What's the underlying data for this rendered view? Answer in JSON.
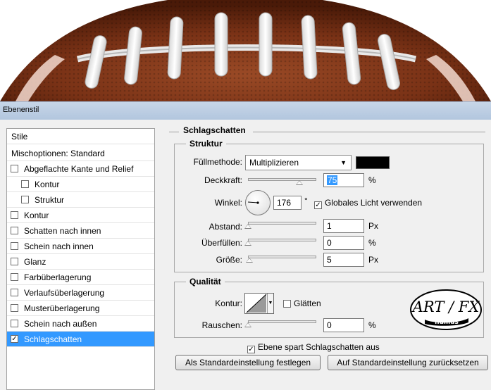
{
  "dialog": {
    "title": "Ebenenstil"
  },
  "style_list": {
    "header": "Stile",
    "items": [
      {
        "label": "Mischoptionen: Standard",
        "checkbox": false,
        "checked": false,
        "indent": 0,
        "selected": false
      },
      {
        "label": "Abgeflachte Kante und Relief",
        "checkbox": true,
        "checked": false,
        "indent": 0,
        "selected": false
      },
      {
        "label": "Kontur",
        "checkbox": true,
        "checked": false,
        "indent": 1,
        "selected": false
      },
      {
        "label": "Struktur",
        "checkbox": true,
        "checked": false,
        "indent": 1,
        "selected": false
      },
      {
        "label": "Kontur",
        "checkbox": true,
        "checked": false,
        "indent": 0,
        "selected": false
      },
      {
        "label": "Schatten nach innen",
        "checkbox": true,
        "checked": false,
        "indent": 0,
        "selected": false
      },
      {
        "label": "Schein nach innen",
        "checkbox": true,
        "checked": false,
        "indent": 0,
        "selected": false
      },
      {
        "label": "Glanz",
        "checkbox": true,
        "checked": false,
        "indent": 0,
        "selected": false
      },
      {
        "label": "Farbüberlagerung",
        "checkbox": true,
        "checked": false,
        "indent": 0,
        "selected": false
      },
      {
        "label": "Verlaufsüberlagerung",
        "checkbox": true,
        "checked": false,
        "indent": 0,
        "selected": false
      },
      {
        "label": "Musterüberlagerung",
        "checkbox": true,
        "checked": false,
        "indent": 0,
        "selected": false
      },
      {
        "label": "Schein nach außen",
        "checkbox": true,
        "checked": false,
        "indent": 0,
        "selected": false
      },
      {
        "label": "Schlagschatten",
        "checkbox": true,
        "checked": true,
        "indent": 0,
        "selected": true
      }
    ]
  },
  "panel": {
    "title": "Schlagschatten",
    "struktur": {
      "title": "Struktur",
      "fuellmethode_label": "Füllmethode:",
      "fuellmethode_value": "Multiplizieren",
      "color": "#000000",
      "deckkraft_label": "Deckkraft:",
      "deckkraft_value": "75",
      "deckkraft_fraction": 0.75,
      "deckkraft_unit": "%",
      "winkel_label": "Winkel:",
      "winkel_value": "176",
      "winkel_unit": "°",
      "global_light_label": "Globales Licht verwenden",
      "global_light_checked": true,
      "abstand_label": "Abstand:",
      "abstand_value": "1",
      "abstand_unit": "Px",
      "abstand_fraction": 0.0,
      "ueberfuellen_label": "Überfüllen:",
      "ueberfuellen_value": "0",
      "ueberfuellen_unit": "%",
      "ueberfuellen_fraction": 0.0,
      "groesse_label": "Größe:",
      "groesse_value": "5",
      "groesse_unit": "Px",
      "groesse_fraction": 0.02
    },
    "qualitaet": {
      "title": "Qualität",
      "kontur_label": "Kontur:",
      "glaetten_label": "Glätten",
      "glaetten_checked": false,
      "rauschen_label": "Rauschen:",
      "rauschen_value": "0",
      "rauschen_unit": "%",
      "rauschen_fraction": 0.0
    },
    "ebene_label": "Ebene spart Schlagschatten aus",
    "ebene_checked": true,
    "btn_default_set": "Als Standardeinstellung festlegen",
    "btn_default_reset": "Auf Standardeinstellung zurücksetzen"
  },
  "logo": {
    "text_top": "ART / FX",
    "text_bottom": "nullius"
  },
  "colors": {
    "selection": "#3399ff",
    "titlebar": "#b9cbe1",
    "leather": "#8a3e1f",
    "lace": "#ffffff"
  }
}
